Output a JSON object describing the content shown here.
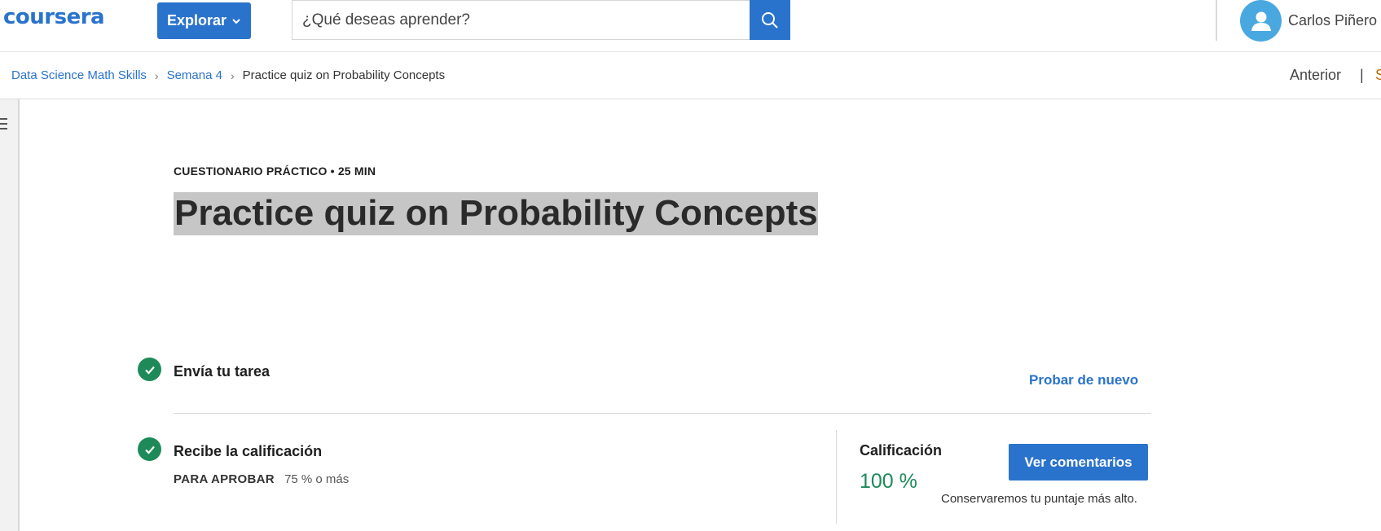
{
  "header": {
    "logo_text": "coursera",
    "explore_label": "Explorar",
    "search_placeholder": "¿Qué deseas aprender?",
    "user_name": "Carlos Piñero"
  },
  "breadcrumb": {
    "items": [
      {
        "label": "Data Science Math Skills"
      },
      {
        "label": "Semana 4"
      }
    ],
    "current": "Practice quiz on Probability Concepts",
    "previous_label": "Anterior",
    "separator": "|",
    "next_peek": "S"
  },
  "quiz": {
    "kicker": "CUESTIONARIO PRÁCTICO • 25 MIN",
    "title": "Practice quiz on Probability Concepts",
    "steps": [
      {
        "title": "Envía tu tarea",
        "action_label": "Probar de nuevo"
      },
      {
        "title": "Recibe la calificación",
        "pass_label": "PARA APROBAR",
        "pass_value": "75 % o más"
      }
    ],
    "grade_label": "Calificación",
    "grade_value": "100 %",
    "feedback_button": "Ver comentarios",
    "keep_note": "Conservaremos tu puntaje más alto."
  },
  "colors": {
    "brand_blue": "#2a73cc",
    "success_green": "#1e8a59",
    "avatar_blue": "#4aa8e0"
  },
  "icons": [
    "chevron-down-icon",
    "search-icon",
    "user-icon",
    "menu-icon",
    "check-icon"
  ]
}
